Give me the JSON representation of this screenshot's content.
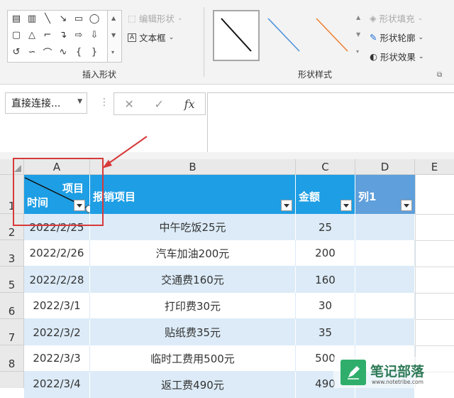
{
  "ribbon": {
    "edit_shape": "编辑形状",
    "text_box": "文本框",
    "insert_shapes_label": "插入形状",
    "shape_styles_label": "形状样式",
    "shape_fill": "形状填充",
    "shape_outline": "形状轮廓",
    "shape_effects": "形状效果"
  },
  "name_box": {
    "value": "直接连接..."
  },
  "formula_bar": {
    "cancel": "✕",
    "confirm": "✓",
    "fx": "fx",
    "value": ""
  },
  "columns": [
    "A",
    "B",
    "C",
    "D",
    "E"
  ],
  "rows": [
    "1",
    "2",
    "3",
    "5",
    "6",
    "7",
    "8"
  ],
  "header": {
    "a_top": "项目",
    "a_bottom": "时间",
    "b": "报销项目",
    "c": "金额",
    "d": "列1"
  },
  "table": [
    [
      "2022/2/25",
      "中午吃饭25元",
      "25"
    ],
    [
      "2022/2/26",
      "汽车加油200元",
      "200"
    ],
    [
      "2022/2/28",
      "交通费160元",
      "160"
    ],
    [
      "2022/3/1",
      "打印费30元",
      "30"
    ],
    [
      "2022/3/2",
      "贴纸费35元",
      "35"
    ],
    [
      "2022/3/3",
      "临时工费用500元",
      "500"
    ],
    [
      "2022/3/4",
      "返工费490元",
      "490"
    ]
  ],
  "watermark": {
    "title": "笔记部落",
    "url": "www.notetribe.com"
  },
  "colors": {
    "header_blue": "#1e9ee4",
    "band_light": "#dcebf7",
    "callout_red": "#d83a3a",
    "watermark_green": "#2fae6b"
  }
}
